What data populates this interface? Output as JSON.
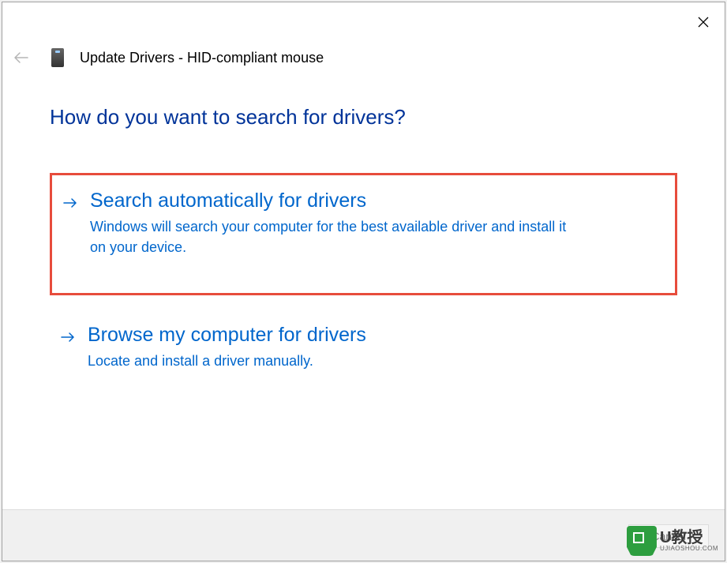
{
  "window": {
    "title": "Update Drivers - HID-compliant mouse"
  },
  "content": {
    "question": "How do you want to search for drivers?"
  },
  "options": {
    "auto": {
      "title": "Search automatically for drivers",
      "description": "Windows will search your computer for the best available driver and install it on your device."
    },
    "browse": {
      "title": "Browse my computer for drivers",
      "description": "Locate and install a driver manually."
    }
  },
  "footer": {
    "cancel": "Cancel"
  },
  "watermark": {
    "brand": "U教授",
    "url": "UJIAOSHOU.COM"
  }
}
